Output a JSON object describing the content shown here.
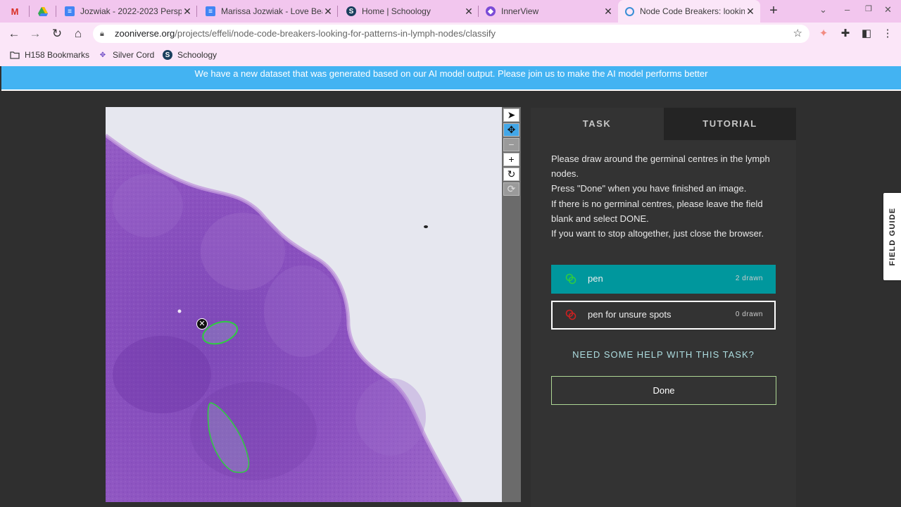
{
  "browser": {
    "tabs": [
      {
        "title": "",
        "icon": "gmail-icon"
      },
      {
        "title": "",
        "icon": "google-drive-icon"
      },
      {
        "title": "Jozwiak - 2022-2023 Persp",
        "icon": "docs-icon"
      },
      {
        "title": "Marissa Jozwiak - Love Bea",
        "icon": "docs-icon"
      },
      {
        "title": "Home | Schoology",
        "icon": "schoology-icon"
      },
      {
        "title": "InnerView",
        "icon": "innerview-icon"
      },
      {
        "title": "Node Code Breakers: lookin",
        "icon": "zooniverse-icon",
        "active": true
      }
    ],
    "address": {
      "domain": "zooniverse.org",
      "path": "/projects/effeli/node-code-breakers-looking-for-patterns-in-lymph-nodes/classify"
    },
    "bookmarks": [
      {
        "label": "H158 Bookmarks",
        "icon": "folder-icon"
      },
      {
        "label": "Silver Cord",
        "icon": "innerview-icon"
      },
      {
        "label": "Schoology",
        "icon": "schoology-icon"
      }
    ]
  },
  "banner": {
    "text": "We have a new dataset that was generated based on our AI model output. Please join us to make the AI model performs better"
  },
  "viewer_tools": [
    {
      "icon": "pointer-icon",
      "active": false
    },
    {
      "icon": "move-icon",
      "active": true
    },
    {
      "icon": "zoom-out-icon",
      "active": false,
      "dim": true
    },
    {
      "icon": "zoom-in-icon",
      "active": false
    },
    {
      "icon": "rotate-icon",
      "active": false
    },
    {
      "icon": "reset-icon",
      "active": false,
      "dim": true
    }
  ],
  "task_panel": {
    "tabs": {
      "task": "TASK",
      "tutorial": "TUTORIAL"
    },
    "instructions": [
      "Please draw around the germinal centres in the lymph nodes.",
      "Press \"Done\" when you have finished an image.",
      "If there is no germinal centres, please leave the field blank and select DONE.",
      "If you want to stop altogether, just close the browser."
    ],
    "tools": [
      {
        "label": "pen",
        "count": "2 drawn",
        "color": "#2ecc40",
        "selected": true
      },
      {
        "label": "pen for unsure spots",
        "count": "0 drawn",
        "color": "#cc2020",
        "selected": false
      }
    ],
    "help_link": "NEED SOME HELP WITH THIS TASK?",
    "done_label": "Done"
  },
  "field_guide": {
    "label": "FIELD GUIDE"
  },
  "colors": {
    "accent": "#00979d",
    "banner": "#43b3f2",
    "tissue": "#8c4fc0",
    "annotation": "#2ecc40"
  }
}
